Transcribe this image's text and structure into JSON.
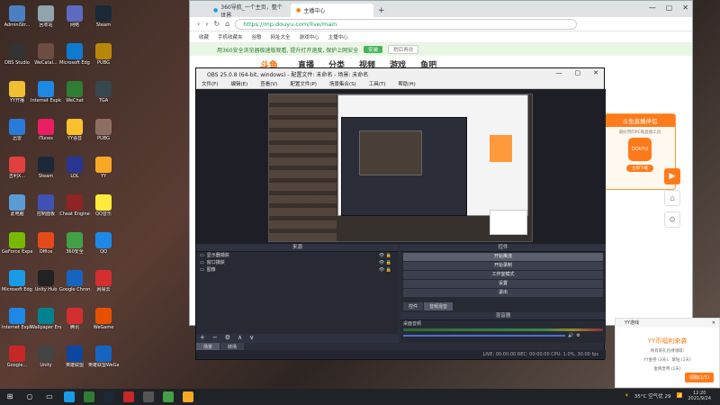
{
  "desktop": {
    "icons": [
      {
        "label": "AdminiStr...",
        "color": "#4a7fc1"
      },
      {
        "label": "OBS Studio",
        "color": "#333333"
      },
      {
        "label": "YY开播",
        "color": "#f0c030"
      },
      {
        "label": "迅雷",
        "color": "#2a7ad8"
      },
      {
        "label": "吉利X...",
        "color": "#e04040"
      },
      {
        "label": "此电脑",
        "color": "#5b9bd5"
      },
      {
        "label": "GeForce Experience",
        "color": "#76b900"
      },
      {
        "label": "Microsoft Edge",
        "color": "#1a9be6"
      },
      {
        "label": "Internet Explorer",
        "color": "#1e88e5"
      },
      {
        "label": "Google...",
        "color": "#c62828"
      },
      {
        "label": "回收站",
        "color": "#90a4ae"
      },
      {
        "label": "WeCatal...",
        "color": "#6d4c41"
      },
      {
        "label": "Internet Explorer",
        "color": "#1e88e5"
      },
      {
        "label": "iTunes",
        "color": "#e91e63"
      },
      {
        "label": "Steam",
        "color": "#1b2838"
      },
      {
        "label": "控制面板",
        "color": "#3f51b5"
      },
      {
        "label": "Office",
        "color": "#e64a19"
      },
      {
        "label": "Unity Hub",
        "color": "#222222"
      },
      {
        "label": "Wallpaper Engine",
        "color": "#00838f"
      },
      {
        "label": "Unity",
        "color": "#444444"
      },
      {
        "label": "网络",
        "color": "#5c6bc0"
      },
      {
        "label": "Microsoft Edge",
        "color": "#0f7bd0"
      },
      {
        "label": "WeChat",
        "color": "#2e7d32"
      },
      {
        "label": "YY语音",
        "color": "#fbc02d"
      },
      {
        "label": "LOL",
        "color": "#283593"
      },
      {
        "label": "Cheat Engine",
        "color": "#8e2424"
      },
      {
        "label": "360安全",
        "color": "#43a047"
      },
      {
        "label": "Google Chrome",
        "color": "#1565c0"
      },
      {
        "label": "腾讯",
        "color": "#d32f2f"
      },
      {
        "label": "英雄联盟",
        "color": "#0d47a1"
      },
      {
        "label": "Steam",
        "color": "#1b2838"
      },
      {
        "label": "PUBG",
        "color": "#b8860b"
      },
      {
        "label": "TGA",
        "color": "#37474f"
      },
      {
        "label": "PUBG",
        "color": "#8d6e63"
      },
      {
        "label": "YY",
        "color": "#f9a825"
      },
      {
        "label": "QQ音乐",
        "color": "#ffeb3b"
      },
      {
        "label": "QQ",
        "color": "#1e88e5"
      },
      {
        "label": "网易云",
        "color": "#d32f2f"
      },
      {
        "label": "WeGame",
        "color": "#e65100"
      },
      {
        "label": "英雄联盟WeGame版",
        "color": "#1565c0"
      }
    ]
  },
  "browser": {
    "tabs": [
      "360导航_一个主页，整个世界",
      "主播中心"
    ],
    "url": "https://mp.douyu.com/live/main",
    "bookmarks": [
      "收藏",
      "手机收藏夹",
      "谷歌",
      "网址大全",
      "游戏中心",
      "主播中心"
    ],
    "warning": "用360安全浏览器极速版观看, 提升打开速度, 保护上网安全",
    "warning_btn": "安装",
    "warning_btn2": "稍后再说",
    "site_logo": "斗鱼",
    "nav": [
      "直播",
      "分类",
      "视频",
      "游戏",
      "鱼吧"
    ],
    "promo_title": "斗鱼直播伴侣",
    "promo_sub": "最好用的PC端直播工具",
    "promo_logo": "DOUYU",
    "promo_btn": "立即下载",
    "side_icons": [
      "play-icon",
      "home-icon",
      "gear-icon"
    ]
  },
  "obs": {
    "title": "OBS 25.0.8 (64-bit, windows) - 配置文件: 未命名 - 场景: 未命名",
    "menu": [
      "文件(F)",
      "编辑(E)",
      "查看(V)",
      "配置文件(P)",
      "场景集合(S)",
      "工具(T)",
      "帮助(H)"
    ],
    "sources_header": "来源",
    "sources": [
      {
        "name": "显示器捕获",
        "vis": "👁 🔒"
      },
      {
        "name": "窗口捕获",
        "vis": "👁 🔒"
      },
      {
        "name": "图像",
        "vis": "👁 🔒"
      }
    ],
    "controls_header": "控件",
    "controls": [
      "开始推流",
      "开始录制",
      "工作室模式",
      "设置",
      "退出"
    ],
    "mixer_tabs": [
      "控件",
      "音频混音"
    ],
    "mixer_header": "混音器",
    "mixer_label": "桌面音频",
    "vol": "0.0 dB",
    "bottom_tabs": [
      "场景",
      "转场"
    ],
    "status": "LIVE: 00:00:00  REC: 00:00:00  CPU: 1.0%, 30.00 fps"
  },
  "notif": {
    "header": "YY游戏",
    "title": "YY币福利来袭",
    "body1": "你有新礼包待领取:",
    "body2": "YY金券 (3天)、紫钻 (1天)",
    "body3": "金牌皇帝 (1天)",
    "button": "领取(1/1)"
  },
  "taskbar": {
    "weather": "35°C 空气优 29",
    "time": "12:20",
    "date": "2021/9/24"
  }
}
